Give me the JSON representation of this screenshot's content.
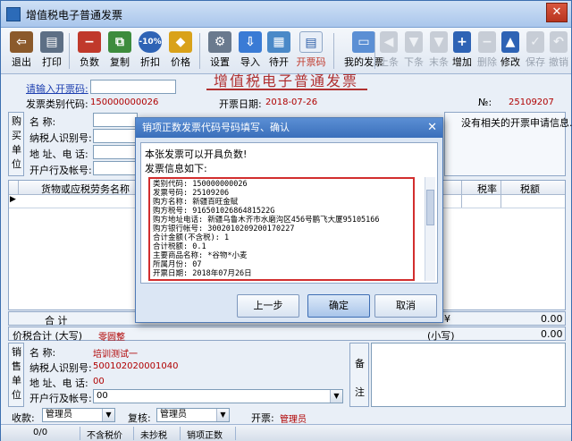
{
  "window": {
    "title": "增值税电子普通发票"
  },
  "toolbar": {
    "exit": "退出",
    "print": "打印",
    "negative": "负数",
    "copy": "复制",
    "discount": "折扣",
    "price": "价格",
    "settings": "设置",
    "import": "导入",
    "issue": "待开",
    "invoice_code": "开票码",
    "my_invoices": "我的发票",
    "first": "上条",
    "next": "下条",
    "last": "末条",
    "add": "增加",
    "delete": "删除",
    "modify": "修改",
    "save": "保存",
    "cancel": "撤销",
    "discount_badge": "-10%"
  },
  "invoice": {
    "heading": "增值税电子普通发票",
    "input_prompt": "请输入开票码:",
    "category_code_label": "发票类别代码:",
    "category_code": "150000000026",
    "date_label": "开票日期:",
    "date": "2018-07-26",
    "no_label": "№:",
    "number": "25109207",
    "no_requests": "没有相关的开票申请信息."
  },
  "buyer": {
    "side_label": [
      "购",
      "买",
      "单",
      "位"
    ],
    "name_label": "名        称:",
    "tax_id_label": "纳税人识别号:",
    "address_label": "地  址、电  话:",
    "bank_label": "开户行及帐号:"
  },
  "grid": {
    "col_goods": "货物或应税劳务名称",
    "col_tax_rate": "税率",
    "col_tax_amount": "税额",
    "col_partial": "税)",
    "total_label": "合        计",
    "total_value": "0.00",
    "total_value_right": "0.00",
    "total_mark": "¥",
    "amount_in_words_label": "价税合计 (大写)",
    "amount_in_words": "零圆整",
    "small_label": "(小写)",
    "small_value": "0.00"
  },
  "seller": {
    "side_label": [
      "销",
      "售",
      "单",
      "位"
    ],
    "name_label": "名        称:",
    "name": "培训测试一",
    "tax_id_label": "纳税人识别号:",
    "tax_id": "500102020001040",
    "address_label": "地  址、电  话:",
    "address": "00",
    "bank_label": "开户行及帐号:",
    "bank": "00",
    "remark_label": [
      "备",
      "注"
    ]
  },
  "signatures": {
    "payee_label": "收款:",
    "payee": "管理员",
    "reviewer_label": "复核:",
    "reviewer": "管理员",
    "drawer_label": "开票:",
    "drawer": "管理员"
  },
  "status": {
    "count": "0/0",
    "tax_mode": "不含税价",
    "report_state": "未抄税",
    "type": "销项正数"
  },
  "dialog": {
    "title": "销项正数发票代码号码填写、确认",
    "message": "本张发票可以开具负数!",
    "info_title": "发票信息如下:",
    "lines": [
      "类别代码: 150000000026",
      "发票号码: 25109206",
      "购方名称: 新疆百旺金赋",
      "购方税号: 91650102686481522G",
      "购方地址电话: 新疆乌鲁木齐市水磨沟区456号鹏飞大厦95105166",
      "购方银行帐号: 3002010209200170227",
      "合计金额(不含税): 1",
      "合计税额: 0.1",
      "主要商品名称: *谷物*小麦",
      "所属月份: 07",
      "开票日期: 2018年07月26日"
    ],
    "prev": "上一步",
    "confirm": "确定",
    "cancel": "取消"
  },
  "colors": {
    "accent": "#3a6fbb",
    "highlight": "#d22e2e",
    "value_red": "#b00000",
    "label_blue": "#1d3fb0"
  }
}
